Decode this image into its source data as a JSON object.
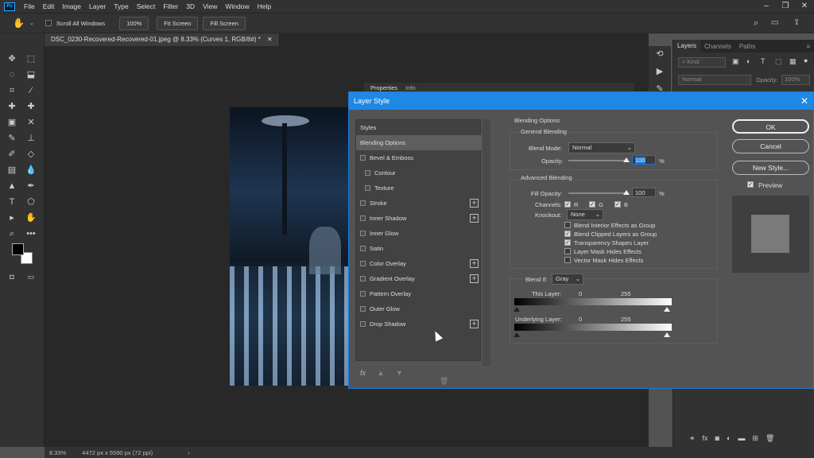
{
  "menu": {
    "app_icon": "Ps",
    "items": [
      "File",
      "Edit",
      "Image",
      "Layer",
      "Type",
      "Select",
      "Filter",
      "3D",
      "View",
      "Window",
      "Help"
    ]
  },
  "options": {
    "scroll_all_windows": "Scroll All Windows",
    "zoom": "100%",
    "fit_screen": "Fit Screen",
    "fill_screen": "Fill Screen"
  },
  "document": {
    "tab_title": "DSC_0230-Recovered-Recovered-01.jpeg @ 8.33% (Curves 1, RGB/8#) *"
  },
  "status": {
    "zoom": "8.33%",
    "dimensions": "4472 px x 5590 px (72 ppi)"
  },
  "properties_strip": {
    "tabs": [
      "Properties",
      "Info"
    ]
  },
  "layers_panel": {
    "tabs": [
      "Layers",
      "Channels",
      "Paths"
    ],
    "kind": "Kind",
    "blend_mode": "Normal",
    "opacity_label": "Opacity:",
    "opacity_value": "100%"
  },
  "dialog": {
    "title": "Layer Style",
    "styles_header": "Styles",
    "style_items": [
      {
        "label": "Blending Options",
        "checkbox": false,
        "plus": false,
        "indent": false,
        "selected": true
      },
      {
        "label": "Bevel & Emboss",
        "checkbox": true,
        "plus": false,
        "indent": false
      },
      {
        "label": "Contour",
        "checkbox": true,
        "plus": false,
        "indent": true
      },
      {
        "label": "Texture",
        "checkbox": true,
        "plus": false,
        "indent": true
      },
      {
        "label": "Stroke",
        "checkbox": true,
        "plus": true,
        "indent": false
      },
      {
        "label": "Inner Shadow",
        "checkbox": true,
        "plus": true,
        "indent": false
      },
      {
        "label": "Inner Glow",
        "checkbox": true,
        "plus": false,
        "indent": false
      },
      {
        "label": "Satin",
        "checkbox": true,
        "plus": false,
        "indent": false
      },
      {
        "label": "Color Overlay",
        "checkbox": true,
        "plus": true,
        "indent": false
      },
      {
        "label": "Gradient Overlay",
        "checkbox": true,
        "plus": true,
        "indent": false
      },
      {
        "label": "Pattern Overlay",
        "checkbox": true,
        "plus": false,
        "indent": false
      },
      {
        "label": "Outer Glow",
        "checkbox": true,
        "plus": false,
        "indent": false
      },
      {
        "label": "Drop Shadow",
        "checkbox": true,
        "plus": true,
        "indent": false
      }
    ],
    "fx_label": "fx",
    "blending_options": {
      "title": "Blending Options",
      "general": "General Blending",
      "blend_mode_label": "Blend Mode:",
      "blend_mode_value": "Normal",
      "opacity_label": "Opacity:",
      "opacity_value": "100",
      "percent": "%",
      "advanced": "Advanced Blending",
      "fill_opacity_label": "Fill Opacity:",
      "fill_opacity_value": "100",
      "channels_label": "Channels:",
      "channel_r": "R",
      "channel_g": "G",
      "channel_b": "B",
      "knockout_label": "Knockout:",
      "knockout_value": "None",
      "options": [
        {
          "label": "Blend Interior Effects as Group",
          "checked": false
        },
        {
          "label": "Blend Clipped Layers as Group",
          "checked": true
        },
        {
          "label": "Transparency Shapes Layer",
          "checked": true
        },
        {
          "label": "Layer Mask Hides Effects",
          "checked": false
        },
        {
          "label": "Vector Mask Hides Effects",
          "checked": false
        }
      ],
      "blend_if_label": "Blend If:",
      "blend_if_value": "Gray",
      "this_layer": "This Layer:",
      "underlying_layer": "Underlying Layer:",
      "range_min": "0",
      "range_max": "255"
    },
    "buttons": {
      "ok": "OK",
      "cancel": "Cancel",
      "new_style": "New Style...",
      "preview": "Preview"
    }
  },
  "colors": {
    "accent": "#1e88e5",
    "selection": "#1473e6"
  }
}
